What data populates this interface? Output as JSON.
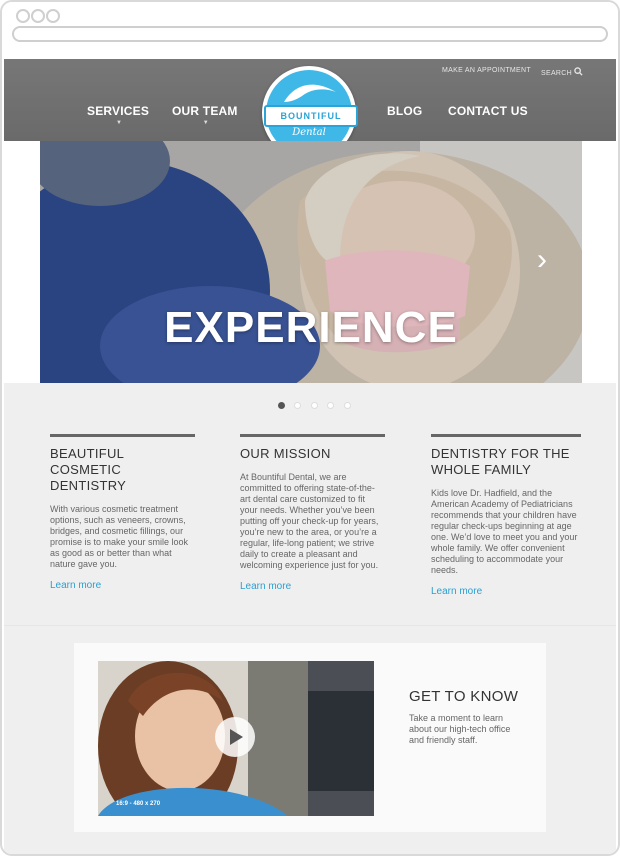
{
  "header": {
    "utility_links": [
      "MAKE AN APPOINTMENT",
      "SEARCH"
    ],
    "nav_left": [
      "SERVICES",
      "OUR TEAM"
    ],
    "nav_right": [
      "BLOG",
      "CONTACT US"
    ],
    "logo": {
      "word": "BOUNTIFUL",
      "script": "Dental"
    }
  },
  "hero": {
    "title": "EXPERIENCE",
    "pager_count": 5,
    "active_index": 0,
    "next_icon": "chevron-right-icon"
  },
  "columns": [
    {
      "heading": "BEAUTIFUL COSMETIC DENTISTRY",
      "body": "With various cosmetic treatment options, such as veneers, crowns, bridges, and cosmetic fillings, our promise is to make your smile look as good as or better than what nature gave you.",
      "link": "Learn more"
    },
    {
      "heading": "OUR MISSION",
      "body": "At Bountiful Dental, we are committed to offering state-of-the-art dental care customized to fit your needs. Whether you’ve been putting off your check-up for years, you’re new to the area, or you’re a regular, life-long patient; we strive daily to create a pleasant and welcoming experience just for you.",
      "link": "Learn more"
    },
    {
      "heading": "DENTISTRY FOR THE WHOLE FAMILY",
      "body": "Kids love Dr. Hadfield, and the American Academy of Pediatricians recommends that your children have regular check-ups beginning at age one. We’d love to meet you and your whole family. We offer convenient scheduling to accommodate your needs.",
      "link": "Learn more"
    }
  ],
  "video_card": {
    "video_label": "16:9 - 480 x 270",
    "heading": "GET TO KNOW",
    "text": "Take a moment to learn about our high-tech office and friendly staff."
  },
  "colors": {
    "accent": "#2b9fd0",
    "header": "#707070",
    "logo": "#3fb8e8"
  }
}
